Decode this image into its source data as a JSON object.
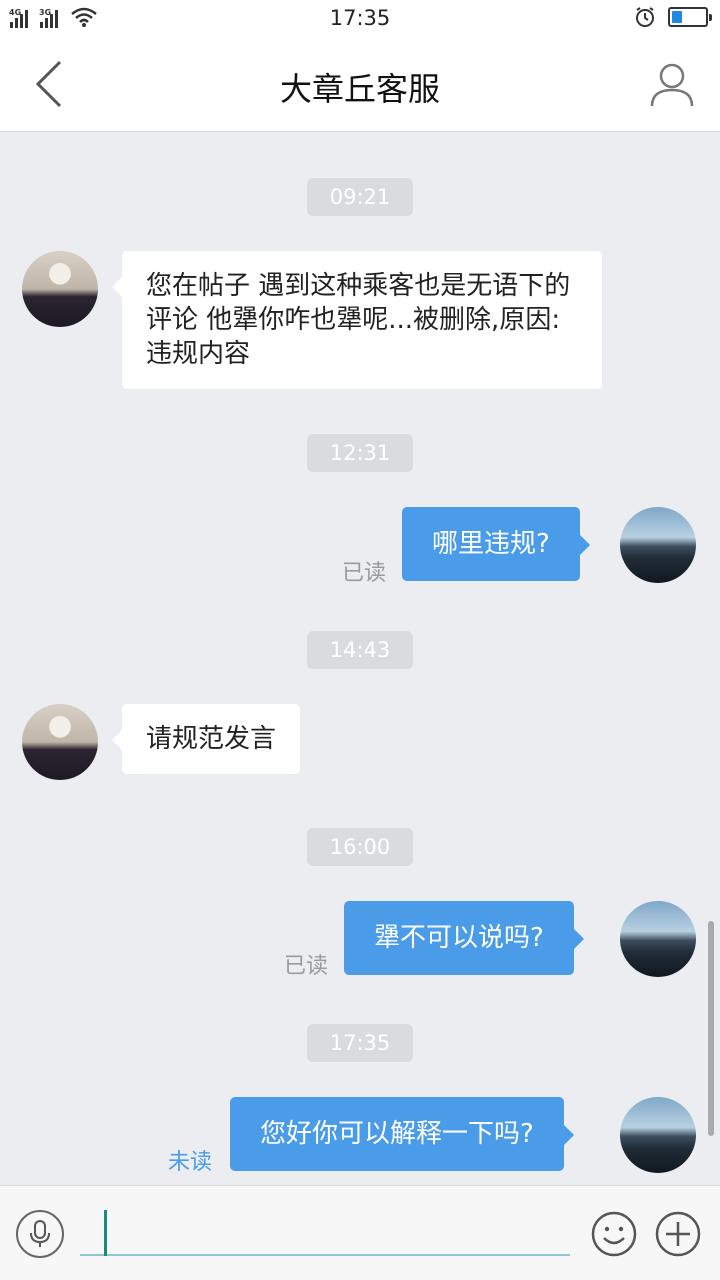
{
  "status_bar": {
    "time": "17:35",
    "network_1": "4G",
    "network_2": "3G",
    "battery_level": 0.3,
    "icons": [
      "signal-icon",
      "wifi-icon",
      "alarm-icon",
      "battery-icon"
    ]
  },
  "header": {
    "title": "大章丘客服",
    "back_icon": "chevron-left-icon",
    "profile_icon": "user-icon"
  },
  "messages": [
    {
      "type": "timestamp",
      "text": "09:21"
    },
    {
      "type": "incoming",
      "text": "您在帖子 遇到这种乘客也是无语下的评论 他犟你咋也犟呢...被删除,原因:违规内容"
    },
    {
      "type": "timestamp",
      "text": "12:31"
    },
    {
      "type": "outgoing",
      "text": "哪里违规?",
      "status": "已读"
    },
    {
      "type": "timestamp",
      "text": "14:43"
    },
    {
      "type": "incoming",
      "text": "请规范发言"
    },
    {
      "type": "timestamp",
      "text": "16:00"
    },
    {
      "type": "outgoing",
      "text": "犟不可以说吗?",
      "status": "已读"
    },
    {
      "type": "timestamp",
      "text": "17:35"
    },
    {
      "type": "outgoing",
      "text": "您好你可以解释一下吗?",
      "status": "未读"
    }
  ],
  "input_bar": {
    "value": "",
    "icons": [
      "microphone-icon",
      "emoji-icon",
      "plus-icon"
    ]
  },
  "colors": {
    "accent": "#4a9be8",
    "background": "#ebedf0",
    "timestamp_bg": "#d9dbdf",
    "unread": "#4a9be8",
    "read": "#9a9a9a"
  }
}
